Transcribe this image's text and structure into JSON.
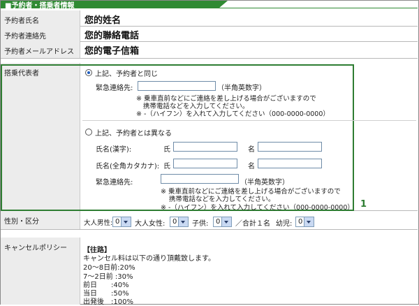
{
  "header": {
    "title": "■予約者・搭乗者情報"
  },
  "booker": {
    "name_label": "予約者氏名",
    "name_value": "您的姓名",
    "contact_label": "予約者連絡先",
    "contact_value": "您的聯絡電話",
    "email_label": "予約者メールアドレス",
    "email_value": "您的電子信箱"
  },
  "passenger": {
    "label": "搭乗代表者",
    "opt_same": "上記、予約者と同じ",
    "emergency_label": "緊急連絡先:",
    "halfwidth_note": "（半角英数字）",
    "note1a": "※ 乗車直前などにご連絡を差し上げる場合がございますので",
    "note1b": "携帯電話などを入力してください。",
    "note2": "※ -（ハイフン）を入れて入力してください（000-0000-0000）",
    "opt_diff": "上記、予約者とは異なる",
    "kanji_label": "氏名(漢字):",
    "kana_label": "氏名(全角カタカナ):",
    "sei": "氏",
    "mei": "名",
    "emergency_label2": "緊急連絡先:",
    "halfwidth_note2": "（半角英数字）",
    "note3a": "※ 乗車直前などにご連絡を差し上げる場合がございますので",
    "note3b": "携帯電話などを入力してください。",
    "note4": "※ -（ハイフン）を入れて入力してください（000-0000-0000）",
    "badge": "1"
  },
  "category": {
    "label": "性別・区分",
    "adult_male": "大人男性:",
    "adult_male_val": "0",
    "adult_female": "大人女性:",
    "adult_female_val": "0",
    "child": "子供:",
    "child_val": "0",
    "total": "／合計１名",
    "infant": "幼児:",
    "infant_val": "0"
  },
  "cancel": {
    "label": "キャンセルポリシー",
    "heading": "【往路】",
    "intro": "キャンセル料は以下の通り頂戴致します。",
    "lines": [
      "20～8日前:20%",
      "7～2日前 :30%",
      "前日　　:40%",
      "当日　　:50%",
      "出発後　:100%"
    ]
  }
}
